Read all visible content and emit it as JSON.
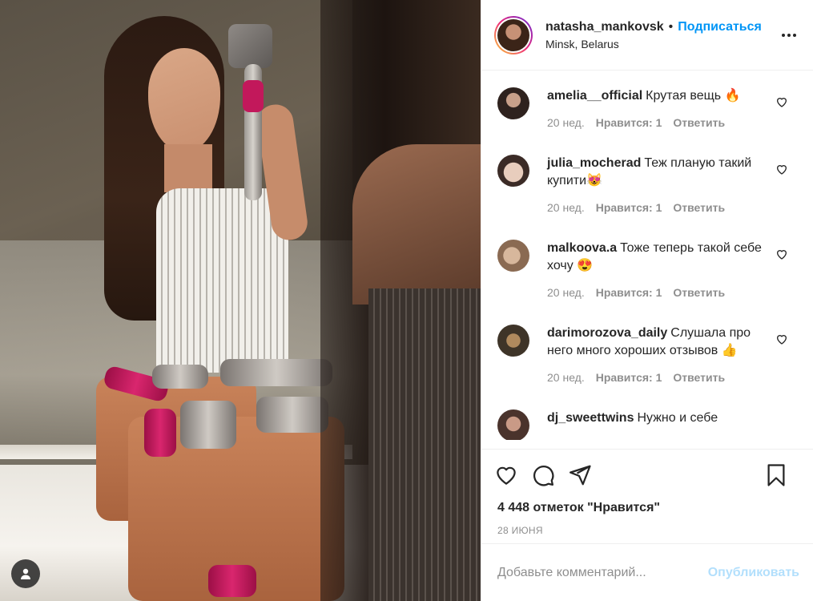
{
  "post": {
    "username": "natasha_mankovsk",
    "separator": "•",
    "follow_label": "Подписаться",
    "location": "Minsk, Belarus"
  },
  "comments": [
    {
      "user": "amelia__official",
      "text": "Крутая вещь 🔥",
      "time": "20 нед.",
      "likes": "Нравится: 1",
      "reply": "Ответить",
      "avatar_color": "#3a2c28"
    },
    {
      "user": "julia_mocherad",
      "text": "Теж планую такий купити😻",
      "time": "20 нед.",
      "likes": "Нравится: 1",
      "reply": "Ответить",
      "avatar_color": "#caa78f"
    },
    {
      "user": "malkoova.a",
      "text": "Тоже теперь такой себе хочу 😍",
      "time": "20 нед.",
      "likes": "Нравится: 1",
      "reply": "Ответить",
      "avatar_color": "#b08a6c"
    },
    {
      "user": "darimorozova_daily",
      "text": "Слушала про него много хороших отзывов 👍",
      "time": "20 нед.",
      "likes": "Нравится: 1",
      "reply": "Ответить",
      "avatar_color": "#7a6248"
    },
    {
      "user": "dj_sweettwins",
      "text": "Нужно и себе",
      "time": "",
      "likes": "",
      "reply": "",
      "avatar_color": "#5a3f38"
    }
  ],
  "actions": {
    "likes_text": "4 448 отметок \"Нравится\"",
    "date": "28 ИЮНЯ"
  },
  "add_comment": {
    "placeholder": "Добавьте комментарий...",
    "publish_label": "Опубликовать"
  },
  "colors": {
    "accent": "#0095f6",
    "publish_disabled": "#b2dffc",
    "meta": "#8e8e8e"
  }
}
